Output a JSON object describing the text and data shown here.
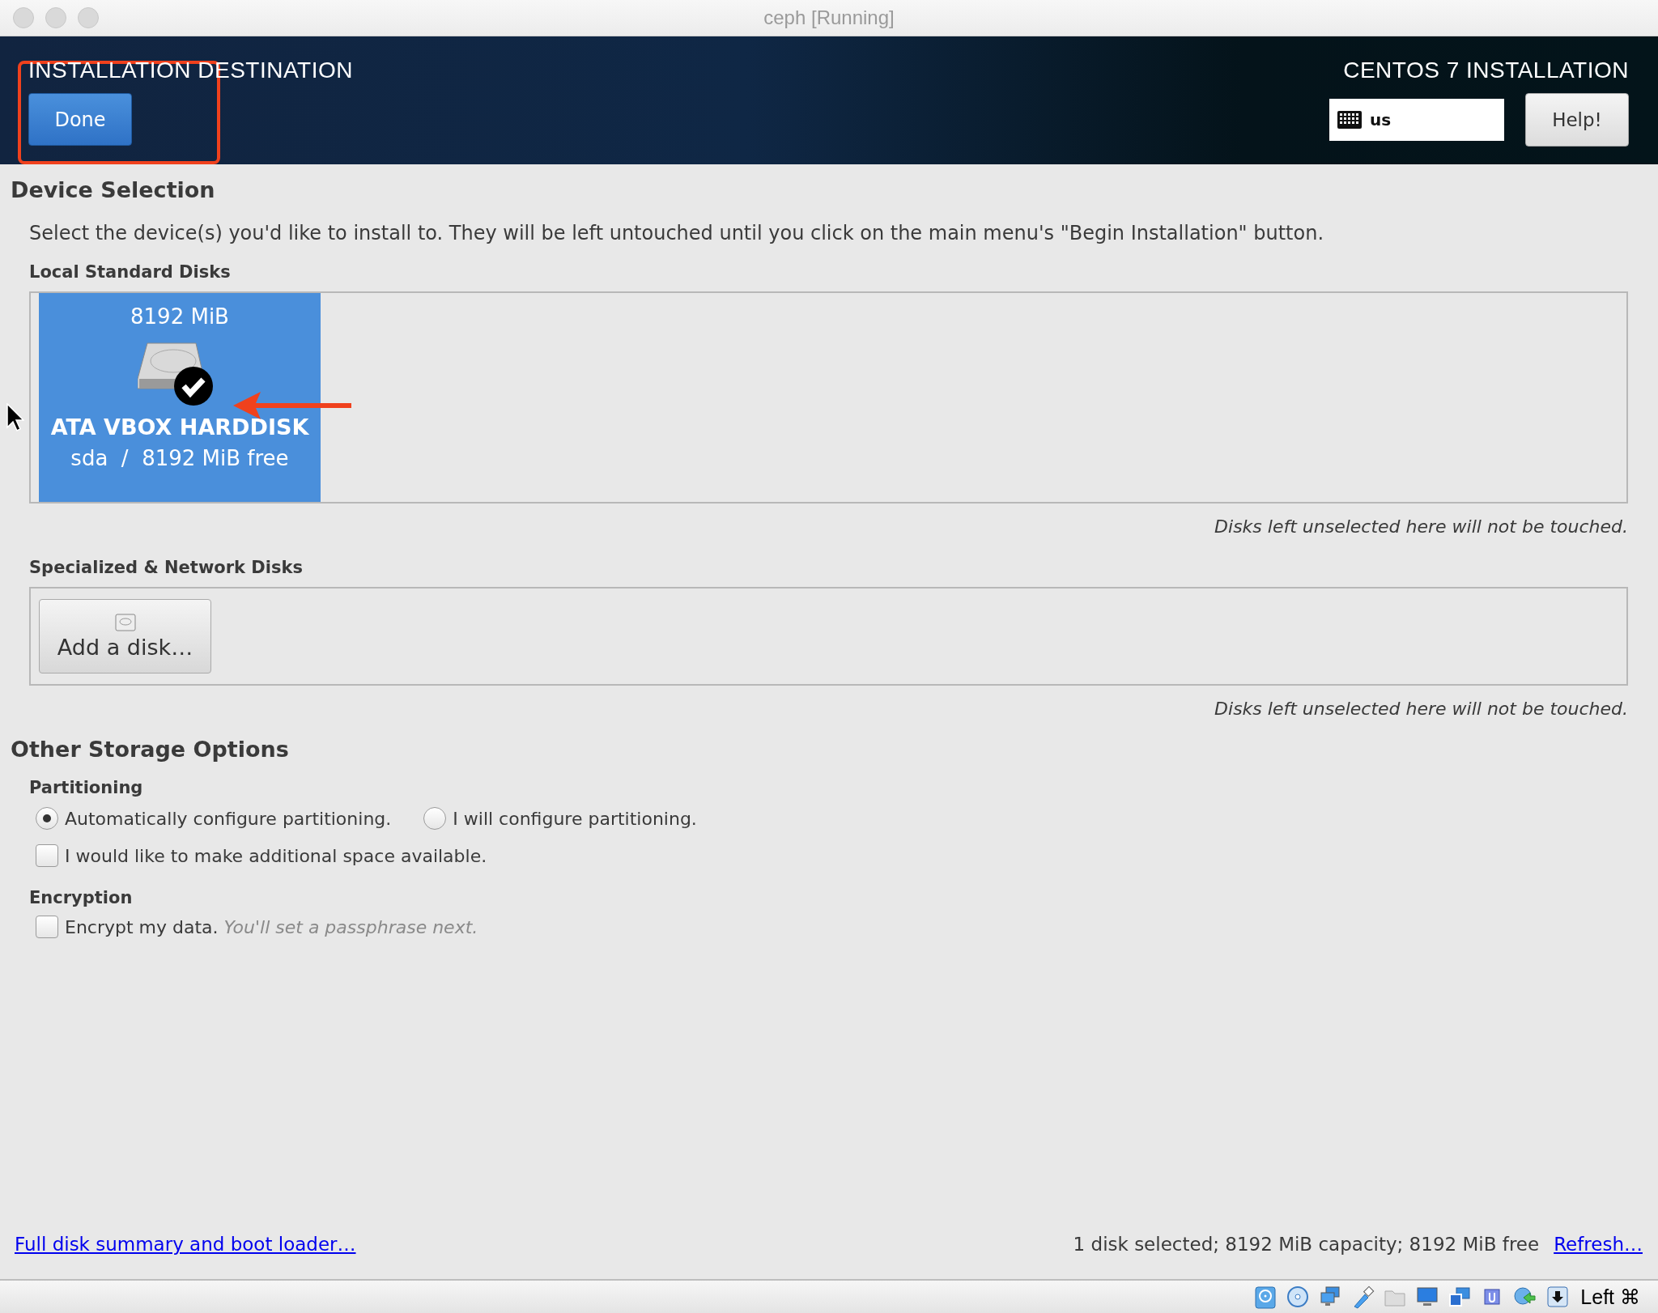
{
  "window": {
    "title": "ceph [Running]"
  },
  "header": {
    "title": "INSTALLATION DESTINATION",
    "done_button": "Done",
    "product": "CENTOS 7 INSTALLATION",
    "keyboard_layout": "us",
    "help_button": "Help!"
  },
  "device_selection": {
    "heading": "Device Selection",
    "description": "Select the device(s) you'd like to install to.  They will be left untouched until you click on the main menu's \"Begin Installation\" button.",
    "local_disks": {
      "heading": "Local Standard Disks",
      "disks": [
        {
          "size": "8192 MiB",
          "name": "ATA VBOX HARDDISK",
          "details": "sda  /  8192 MiB free",
          "selected": true
        }
      ],
      "note": "Disks left unselected here will not be touched."
    },
    "network_disks": {
      "heading": "Specialized & Network Disks",
      "add_button": "Add a disk…",
      "note": "Disks left unselected here will not be touched."
    }
  },
  "other_storage": {
    "heading": "Other Storage Options",
    "partitioning": {
      "heading": "Partitioning",
      "options": [
        {
          "label": "Automatically configure partitioning.",
          "selected": true
        },
        {
          "label": "I will configure partitioning.",
          "selected": false
        }
      ],
      "extra_space": {
        "label": "I would like to make additional space available.",
        "checked": false
      }
    },
    "encryption": {
      "heading": "Encryption",
      "label": "Encrypt my data.",
      "hint": "You'll set a passphrase next.",
      "checked": false
    }
  },
  "footer": {
    "summary_link": "Full disk summary and boot loader…",
    "status": "1 disk selected; 8192 MiB capacity; 8192 MiB free",
    "refresh_link": "Refresh…"
  },
  "vm_status_bar": {
    "host_key": "Left ⌘"
  }
}
